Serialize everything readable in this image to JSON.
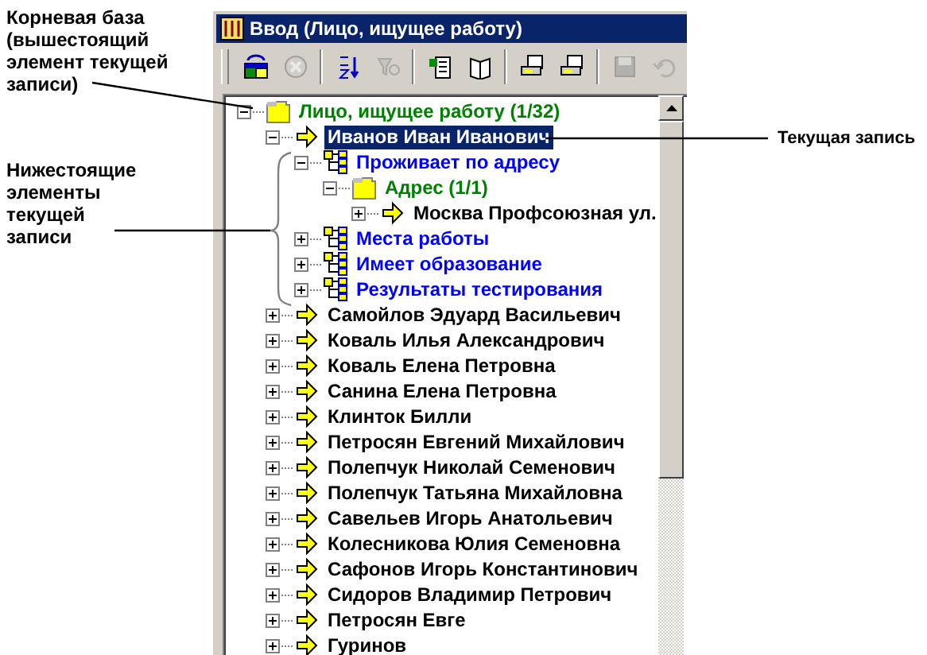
{
  "annotations": {
    "root_base": "Корневая база (вышестоящий элемент текущей записи)",
    "children": "Нижестоящие элементы текущей записи",
    "current": "Текущая запись"
  },
  "window": {
    "title": "Ввод (Лицо, ищущее работу)"
  },
  "toolbar": [
    {
      "kind": "table",
      "disabled": false
    },
    {
      "kind": "cancel",
      "disabled": true
    },
    {
      "kind": "sort",
      "disabled": false
    },
    {
      "kind": "filter",
      "disabled": true
    },
    {
      "kind": "doc",
      "disabled": false
    },
    {
      "kind": "book",
      "disabled": false
    },
    {
      "kind": "print",
      "disabled": false
    },
    {
      "kind": "print",
      "disabled": false
    },
    {
      "kind": "save",
      "disabled": true
    },
    {
      "kind": "undo",
      "disabled": true
    }
  ],
  "tree": [
    {
      "kind": "group",
      "label": "Лицо, ищущее работу (1/32)",
      "expanded": true,
      "selected": false,
      "children": [
        {
          "kind": "record",
          "label": "Иванов Иван Иванович",
          "expanded": true,
          "selected": true,
          "children": [
            {
              "kind": "relation",
              "label": "Проживает по адресу",
              "expanded": true,
              "selected": false,
              "children": [
                {
                  "kind": "group",
                  "label": "Адрес (1/1)",
                  "expanded": true,
                  "selected": false,
                  "children": [
                    {
                      "kind": "record",
                      "label": "Москва Профсоюзная ул.",
                      "expanded": false,
                      "selected": false
                    }
                  ]
                }
              ]
            },
            {
              "kind": "relation",
              "label": "Места работы",
              "expanded": false,
              "selected": false
            },
            {
              "kind": "relation",
              "label": "Имеет образование",
              "expanded": false,
              "selected": false
            },
            {
              "kind": "relation",
              "label": "Результаты тестирования",
              "expanded": false,
              "selected": false
            }
          ]
        },
        {
          "kind": "record",
          "label": "Самойлов Эдуард Васильевич",
          "expanded": false,
          "selected": false
        },
        {
          "kind": "record",
          "label": "Коваль Илья Александрович",
          "expanded": false,
          "selected": false
        },
        {
          "kind": "record",
          "label": "Коваль Елена Петровна",
          "expanded": false,
          "selected": false
        },
        {
          "kind": "record",
          "label": "Санина Елена Петровна",
          "expanded": false,
          "selected": false
        },
        {
          "kind": "record",
          "label": "Клинток Билли",
          "expanded": false,
          "selected": false
        },
        {
          "kind": "record",
          "label": "Петросян Евгений Михайлович",
          "expanded": false,
          "selected": false
        },
        {
          "kind": "record",
          "label": "Полепчук Николай Семенович",
          "expanded": false,
          "selected": false
        },
        {
          "kind": "record",
          "label": "Полепчук Татьяна Михайловна",
          "expanded": false,
          "selected": false
        },
        {
          "kind": "record",
          "label": "Савельев Игорь Анатольевич",
          "expanded": false,
          "selected": false
        },
        {
          "kind": "record",
          "label": "Колесникова Юлия Семеновна",
          "expanded": false,
          "selected": false
        },
        {
          "kind": "record",
          "label": "Сафонов Игорь Константинович",
          "expanded": false,
          "selected": false
        },
        {
          "kind": "record",
          "label": "Сидоров Владимир Петрович",
          "expanded": false,
          "selected": false
        },
        {
          "kind": "record",
          "label": "Петросян Евге",
          "expanded": false,
          "selected": false
        },
        {
          "kind": "record",
          "label": "Гуринов",
          "expanded": false,
          "selected": false
        }
      ]
    }
  ]
}
